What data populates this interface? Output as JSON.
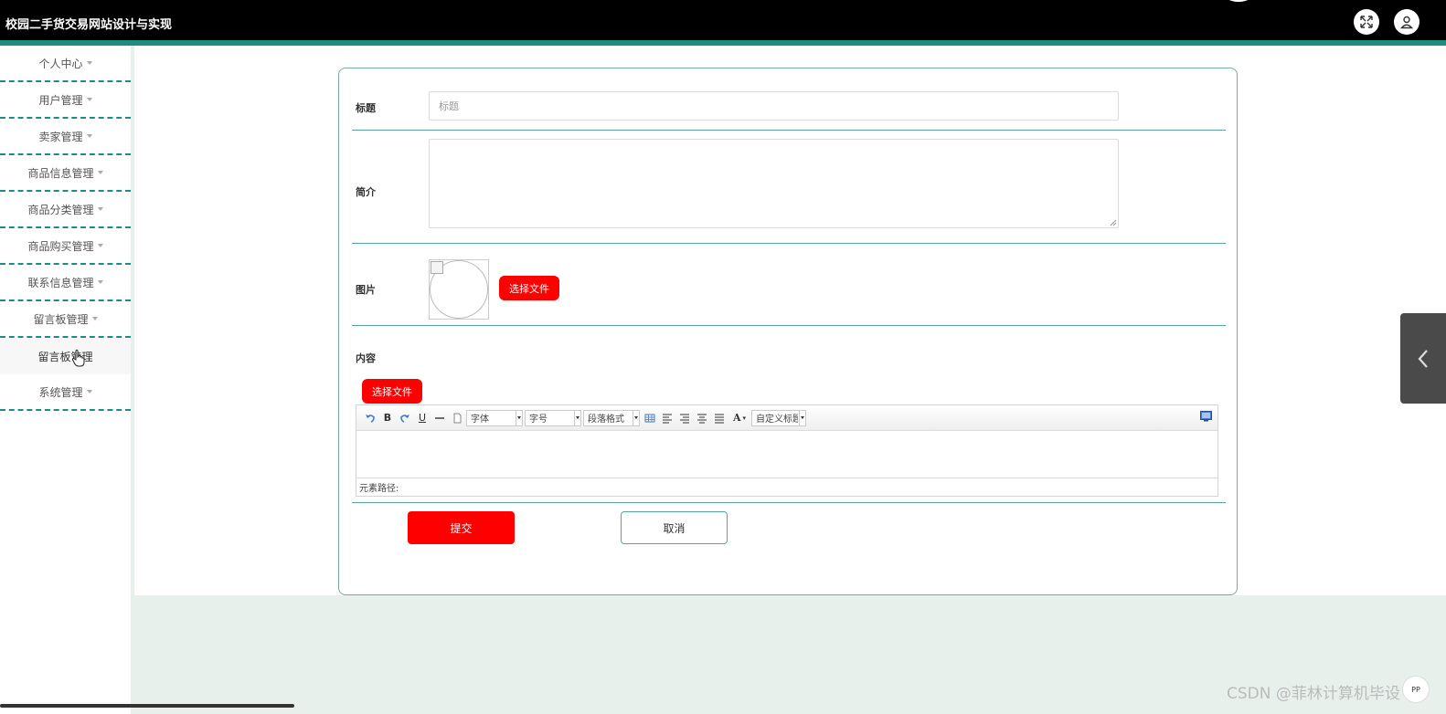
{
  "app": {
    "title": "校园二手货交易网站设计与实现"
  },
  "sidebar": {
    "items": [
      {
        "label": "个人中心"
      },
      {
        "label": "用户管理"
      },
      {
        "label": "卖家管理"
      },
      {
        "label": "商品信息管理"
      },
      {
        "label": "商品分类管理"
      },
      {
        "label": "商品购买管理"
      },
      {
        "label": "联系信息管理"
      },
      {
        "label": "留言板管理"
      }
    ],
    "active_sub": "留言板管理",
    "last_item": "系统管理"
  },
  "form": {
    "title_label": "标题",
    "title_placeholder": "标题",
    "intro_label": "简介",
    "image_label": "图片",
    "choose_file": "选择文件",
    "content_label": "内容",
    "choose_file_2": "选择文件",
    "submit": "提交",
    "cancel": "取消"
  },
  "editor": {
    "font_family": "字体",
    "font_size": "字号",
    "paragraph": "段落格式",
    "custom_title": "自定义标题",
    "element_path": "元素路径:"
  },
  "watermark": "CSDN @菲林计算机毕设",
  "corner_badge": "PP"
}
